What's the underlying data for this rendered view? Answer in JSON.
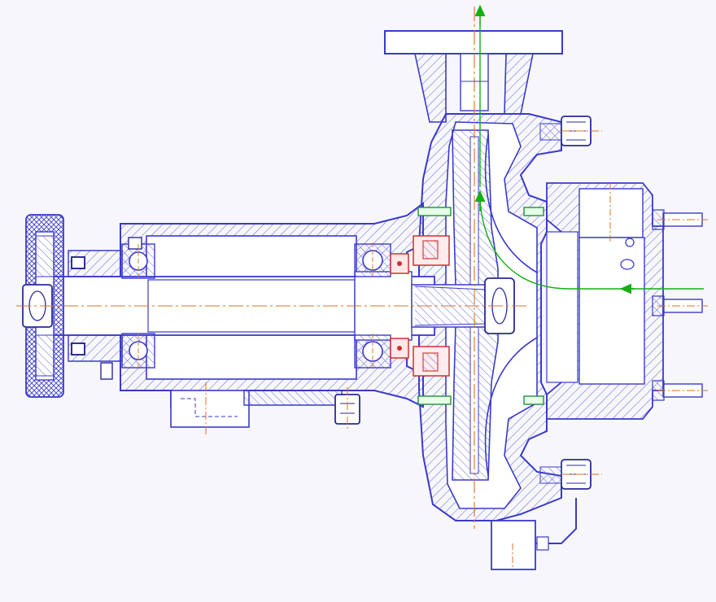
{
  "drawing": {
    "subject": "centrifugal-pump-cross-section",
    "text_labels": [],
    "colors": {
      "background": "#f7f7fb",
      "outline": "#3a3acb",
      "hatch": "#6a6ad8",
      "centerline": "#e07020",
      "flow": "#13b013",
      "seal": "#d03030",
      "seal_accent": "#209040",
      "bolt": "#2a2a9a"
    },
    "parts": [
      {
        "name": "discharge-flange"
      },
      {
        "name": "discharge-nozzle"
      },
      {
        "name": "volute-casing"
      },
      {
        "name": "impeller"
      },
      {
        "name": "suction-cover"
      },
      {
        "name": "suction-nozzle"
      },
      {
        "name": "bearing-housing"
      },
      {
        "name": "shaft"
      },
      {
        "name": "front-bearing"
      },
      {
        "name": "rear-bearing"
      },
      {
        "name": "mechanical-seal"
      },
      {
        "name": "coupling-hub"
      },
      {
        "name": "support-foot"
      },
      {
        "name": "drain-plug"
      },
      {
        "name": "casing-bolts"
      },
      {
        "name": "cover-studs"
      },
      {
        "name": "impeller-nut"
      },
      {
        "name": "flow-arrows"
      },
      {
        "name": "centerlines"
      }
    ]
  }
}
